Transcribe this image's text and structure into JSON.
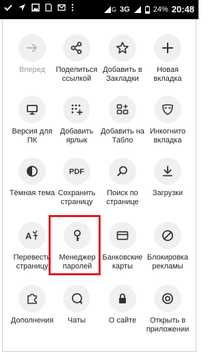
{
  "statusbar": {
    "network": "3G",
    "signal_label": "G",
    "battery": "24%",
    "time": "20:48"
  },
  "menu": [
    {
      "id": "forward",
      "label": "Вперед",
      "icon": "arrow-right-icon",
      "disabled": true
    },
    {
      "id": "share",
      "label": "Поделиться ссылкой",
      "icon": "share-icon"
    },
    {
      "id": "bookmark",
      "label": "Добавить в Закладки",
      "icon": "star-icon"
    },
    {
      "id": "newtab",
      "label": "Новая вкладка",
      "icon": "plus-icon"
    },
    {
      "id": "desktop",
      "label": "Версия для ПК",
      "icon": "monitor-icon"
    },
    {
      "id": "shortcut",
      "label": "Добавить ярлык",
      "icon": "grid-plus-icon"
    },
    {
      "id": "tablo",
      "label": "Добавить на Табло",
      "icon": "tiles-plus-icon"
    },
    {
      "id": "incognito",
      "label": "Инкогнито вкладка",
      "icon": "mask-icon"
    },
    {
      "id": "darktheme",
      "label": "Тёмная тема",
      "icon": "half-circle-icon"
    },
    {
      "id": "savepdf",
      "label": "Сохранить страницу",
      "icon": "pdf-icon"
    },
    {
      "id": "find",
      "label": "Поиск по странице",
      "icon": "search-icon"
    },
    {
      "id": "downloads",
      "label": "Загрузки",
      "icon": "download-icon"
    },
    {
      "id": "translate",
      "label": "Перевести страницу",
      "icon": "translate-icon"
    },
    {
      "id": "passwords",
      "label": "Менеджер паролей",
      "icon": "key-icon"
    },
    {
      "id": "cards",
      "label": "Банковские карты",
      "icon": "card-icon"
    },
    {
      "id": "adblock",
      "label": "Блокировка рекламы",
      "icon": "block-icon"
    },
    {
      "id": "addons",
      "label": "Дополнения",
      "icon": "puzzle-icon"
    },
    {
      "id": "chats",
      "label": "Чаты",
      "icon": "chat-icon"
    },
    {
      "id": "siteinfo",
      "label": "О сайте",
      "icon": "lock-icon"
    },
    {
      "id": "openapp",
      "label": "Открыть в приложении",
      "icon": "open-app-icon"
    }
  ],
  "highlight_color": "#e01b22"
}
